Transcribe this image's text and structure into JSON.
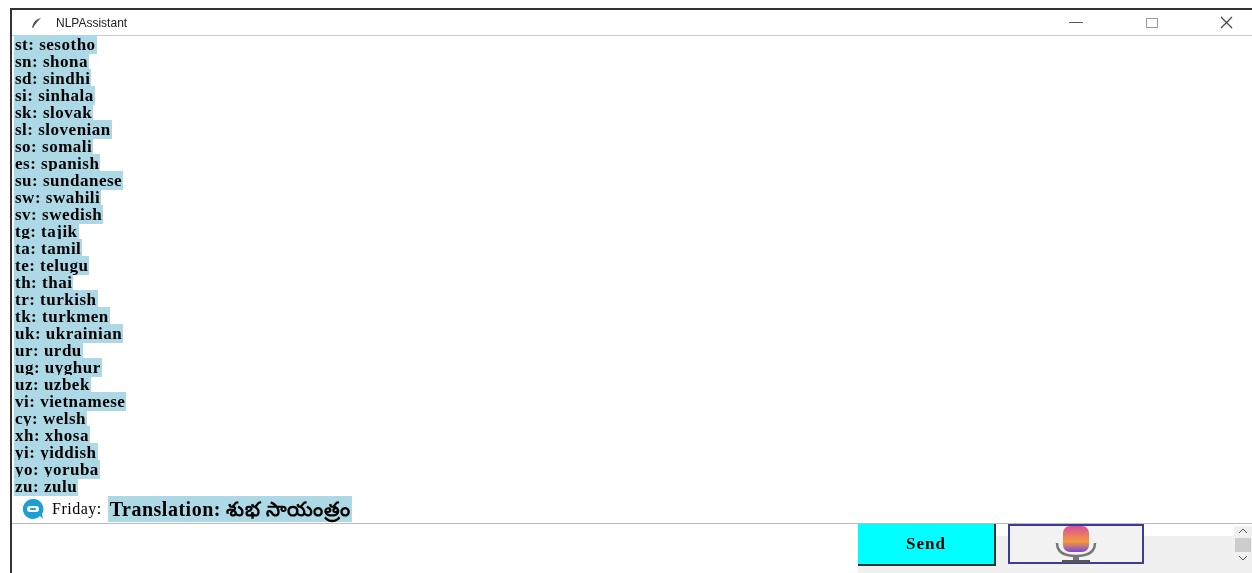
{
  "window": {
    "title": "NLPAssistant"
  },
  "languages": [
    "st: sesotho",
    "sn: shona",
    "sd: sindhi",
    "si: sinhala",
    "sk: slovak",
    "sl: slovenian",
    "so: somali",
    "es: spanish",
    "su: sundanese",
    "sw: swahili",
    "sv: swedish",
    "tg: tajik",
    "ta: tamil",
    "te: telugu",
    "th: thai",
    "tr: turkish",
    "tk: turkmen",
    "uk: ukrainian",
    "ur: urdu",
    "ug: uyghur",
    "uz: uzbek",
    "vi: vietnamese",
    "cy: welsh",
    "xh: xhosa",
    "yi: yiddish",
    "yo: yoruba",
    "zu: zulu"
  ],
  "reply": {
    "sender": "Friday:",
    "text": "Translation: శుభ సాయంత్రం"
  },
  "send_button": "Send"
}
